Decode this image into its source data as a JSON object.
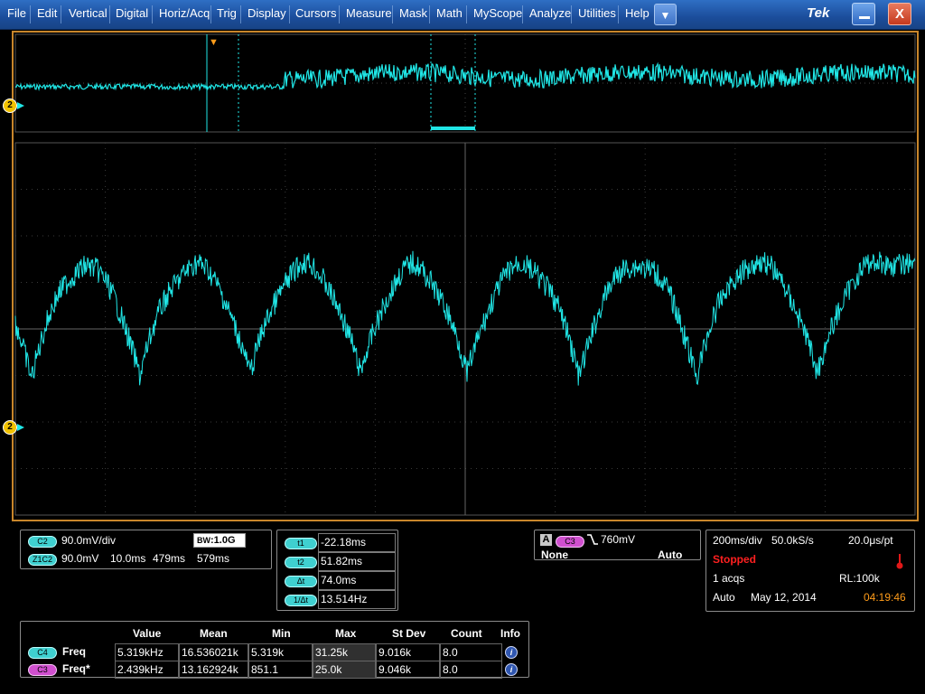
{
  "menu": {
    "items": [
      "File",
      "Edit",
      "Vertical",
      "Digital",
      "Horiz/Acq",
      "Trig",
      "Display",
      "Cursors",
      "Measure",
      "Mask",
      "Math",
      "MyScope",
      "Analyze",
      "Utilities",
      "Help"
    ],
    "dropdown_glyph": "▼",
    "brand": "Tek",
    "minimize_icon": "minimize-icon",
    "close_label": "X"
  },
  "markers": {
    "channel_marker": "2",
    "trigger_marker": "▼"
  },
  "colors": {
    "trace": "#20e6e6",
    "border": "#c8862b",
    "menu": "#1b4d9b",
    "stopped": "#ff2020",
    "time": "#ff9c1a"
  },
  "channel_panel": {
    "ch_label": "C2",
    "ch_scale": "90.0mV/div",
    "bw_prefix": "B",
    "bw_sub": "W",
    "bw_value": ":1.0G",
    "zoom_label": "Z1C2",
    "zoom_scale": "90.0mV",
    "zoom_time": "10.0ms",
    "zoom_pos1": "479ms",
    "zoom_pos2": "579ms"
  },
  "cursor_panel": {
    "rows": [
      {
        "label": "t1",
        "value": "-22.18ms"
      },
      {
        "label": "t2",
        "value": "51.82ms"
      },
      {
        "label": "Δt",
        "value": "74.0ms"
      },
      {
        "label": "1/Δt",
        "value": "13.514Hz"
      }
    ]
  },
  "trigger_panel": {
    "mode_letter": "A",
    "source": "C3",
    "slope_icon": "falling-edge-icon",
    "level": "760mV",
    "coupling": "None",
    "mode": "Auto"
  },
  "acq_panel": {
    "timebase": "200ms/div",
    "sample_rate": "50.0kS/s",
    "time_per_pt": "20.0μs/pt",
    "status": "Stopped",
    "acqs": "1 acqs",
    "record_length": "RL:100k",
    "trigger_mode": "Auto",
    "date": "May 12, 2014",
    "time": "04:19:46"
  },
  "measurements": {
    "headers": [
      "Value",
      "Mean",
      "Min",
      "Max",
      "St Dev",
      "Count",
      "Info"
    ],
    "rows": [
      {
        "source": "C4",
        "name": "Freq",
        "value": "5.319kHz",
        "mean": "16.536021k",
        "min": "5.319k",
        "max": "31.25k",
        "stdev": "9.016k",
        "count": "8.0",
        "info": "i"
      },
      {
        "source": "C3",
        "name": "Freq*",
        "value": "2.439kHz",
        "mean": "13.162924k",
        "min": "851.1",
        "max": "25.0k",
        "stdev": "9.046k",
        "count": "8.0",
        "info": "i"
      }
    ]
  }
}
